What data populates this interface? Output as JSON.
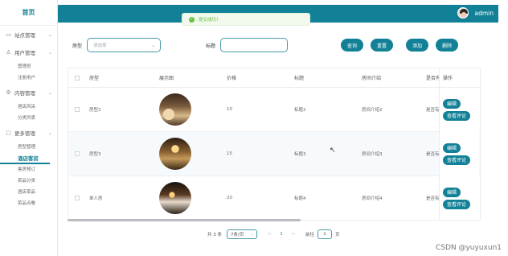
{
  "sidebar": {
    "home": "首页",
    "groups": [
      {
        "label": "站点管理",
        "icon": "monitor-icon",
        "items": []
      },
      {
        "label": "用户管理",
        "icon": "user-icon",
        "items": [
          "管理员",
          "注册用户"
        ]
      },
      {
        "label": "内容管理",
        "icon": "settings-icon",
        "items": [
          "酒店风采",
          "分类列表"
        ]
      },
      {
        "label": "更多管理",
        "icon": "document-icon",
        "items": [
          "房型管理",
          "酒店客房",
          "客房预订",
          "菜品分类",
          "酒店菜品",
          "菜品点餐"
        ]
      }
    ],
    "active": "酒店客房"
  },
  "header": {
    "user": "admin"
  },
  "toast": {
    "message": "提交成功！"
  },
  "filter": {
    "type_label": "房型",
    "type_placeholder": "请选择",
    "title_label": "标题",
    "title_value": "",
    "buttons": [
      "查询",
      "重置",
      "添加",
      "删除"
    ]
  },
  "table": {
    "headers": [
      "房型",
      "展示图",
      "价格",
      "标题",
      "房间介绍",
      "是否有",
      "操作"
    ],
    "rows": [
      {
        "type": "房型2",
        "price": "10",
        "title": "标题2",
        "intro": "房间介绍2",
        "comment": "是否有"
      },
      {
        "type": "房型3",
        "price": "15",
        "title": "标题3",
        "intro": "房间介绍3",
        "comment": "是否有"
      },
      {
        "type": "单人房",
        "price": "20",
        "title": "标题4",
        "intro": "房间介绍4",
        "comment": "是否有"
      }
    ],
    "actions": {
      "edit": "编辑",
      "comments": "查看评论"
    }
  },
  "pager": {
    "total": "共 3 条",
    "page_size": "7条/页",
    "prev": "<",
    "current": "1",
    "next": ">",
    "goto_label": "前往",
    "goto_value": "1",
    "page_suffix": "页"
  },
  "watermark": "CSDN @yuyuxun1",
  "colors": {
    "primary": "#128197",
    "success": "#67c23a"
  }
}
